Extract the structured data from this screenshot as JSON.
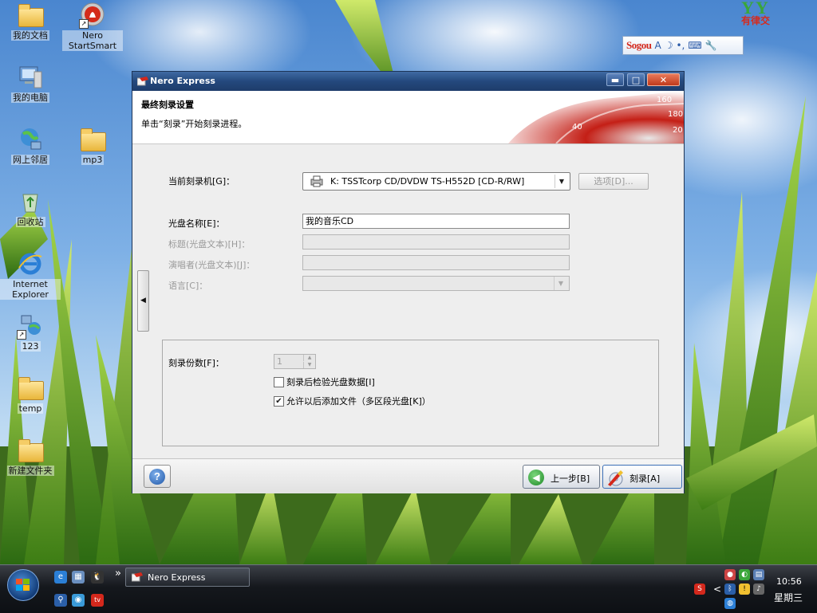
{
  "desktop": {
    "icons": [
      {
        "label": "我的文档"
      },
      {
        "label": "Nero StartSmart"
      },
      {
        "label": "我的电脑"
      },
      {
        "label": "网上邻居"
      },
      {
        "label": "mp3"
      },
      {
        "label": "回收站"
      },
      {
        "label": "Internet Explorer"
      },
      {
        "label": "123"
      },
      {
        "label": "temp"
      },
      {
        "label": "新建文件夹"
      }
    ],
    "sogou_logo": "Sogou",
    "yy_logo_top": "YY",
    "yy_logo_bottom": "有律交"
  },
  "window": {
    "title": "Nero Express",
    "min_label": "▬",
    "max_label": "□",
    "close_label": "✕",
    "header_title": "最终刻录设置",
    "header_subtitle": "单击“刻录”开始刻录进程。",
    "speedo_ticks": [
      "160",
      "180",
      "20",
      "40"
    ],
    "recorder_label": "当前刻录机[G]：",
    "recorder_value": "K: TSSTcorp CD/DVDW TS-H552D   [CD-R/RW]",
    "options_label": "选项[D]...",
    "disc_name_label": "光盘名称[E]：",
    "disc_name_value": "我的音乐CD",
    "title_label": "标题(光盘文本)[H]：",
    "title_value": "",
    "artist_label": "演唱者(光盘文本)[J]：",
    "artist_value": "",
    "language_label": "语言[C]：",
    "language_value": "",
    "copies_label": "刻录份数[F]：",
    "copies_value": "1",
    "verify_label": "刻录后检验光盘数据[I]",
    "verify_checked": false,
    "multisession_label": "允许以后添加文件（多区段光盘[K]）",
    "multisession_checked": true,
    "help_label": "?",
    "back_label": "上一步[B]",
    "burn_label": "刻录[A]"
  },
  "taskbar": {
    "task_nero": "Nero Express",
    "expand": "»",
    "tray_expand": "<",
    "time": "10:56",
    "day": "星期三"
  }
}
